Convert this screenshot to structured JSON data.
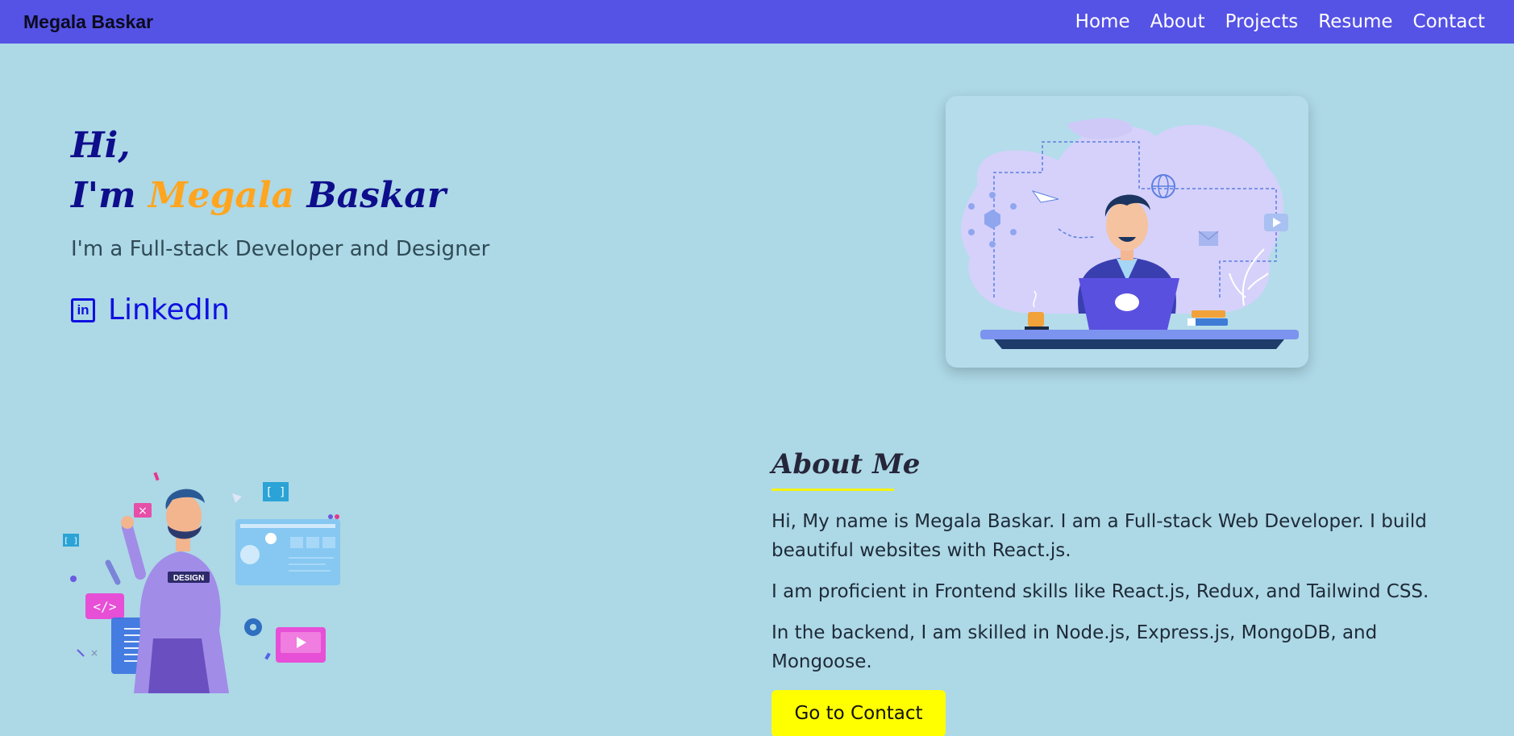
{
  "nav": {
    "brand": "Megala Baskar",
    "links": [
      "Home",
      "About",
      "Projects",
      "Resume",
      "Contact"
    ]
  },
  "hero": {
    "greeting": "Hi,",
    "intro_prefix": "I'm",
    "first_name": "Megala",
    "last_name": "Baskar",
    "subtitle": "I'm a Full-stack Developer and Designer",
    "linkedin_label": "LinkedIn",
    "linkedin_icon": "linkedin-icon",
    "illustration": "developer-at-laptop-illustration"
  },
  "about": {
    "title": "About Me",
    "paragraphs": [
      "Hi, My name is Megala Baskar. I am a Full-stack Web Developer. I build beautiful websites with React.js.",
      "I am proficient in Frontend skills like React.js, Redux, and Tailwind CSS.",
      "In the backend, I am skilled in Node.js, Express.js, MongoDB, and Mongoose."
    ],
    "button_label": "Go to Contact",
    "illustration": "designer-with-ui-panels-illustration"
  },
  "colors": {
    "background": "#add8e6",
    "navbar": "#5552e6",
    "heading": "#0e0e8c",
    "accent": "#ffa51f",
    "link": "#1010e0",
    "button": "#ffff00"
  }
}
